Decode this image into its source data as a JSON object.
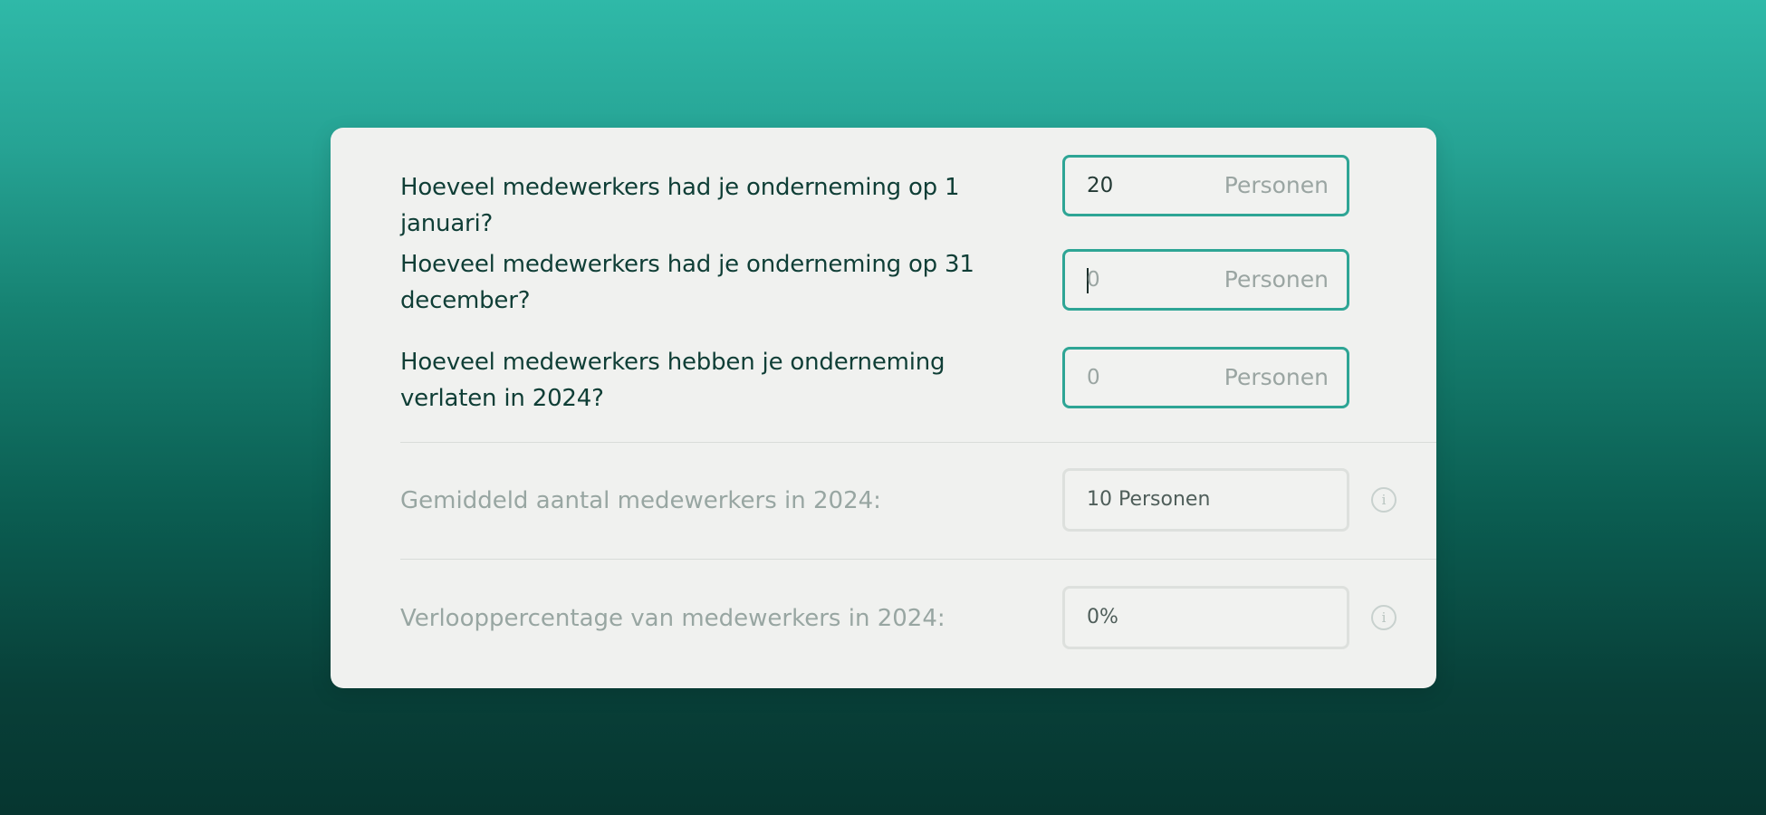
{
  "questions": [
    {
      "label": "Hoeveel medewerkers had je onderneming op 1 januari?",
      "value": "20",
      "unit": "Personen"
    },
    {
      "label": "Hoeveel medewerkers had je onderneming op 31 december?",
      "value": "0",
      "unit": "Personen"
    },
    {
      "label": "Hoeveel medewerkers hebben je onderneming verlaten in 2024?",
      "value": "0",
      "unit": "Personen"
    }
  ],
  "results": [
    {
      "label": "Gemiddeld aantal medewerkers in 2024:",
      "value": "10 Personen",
      "info_icon": "i"
    },
    {
      "label": "Verlooppercentage van medewerkers in 2024:",
      "value": "0%",
      "info_icon": "i"
    }
  ],
  "colors": {
    "accent": "#2ea595",
    "label_dark": "#0f3e36",
    "label_muted": "#98a6a2",
    "card_bg": "#f0f1ef"
  }
}
